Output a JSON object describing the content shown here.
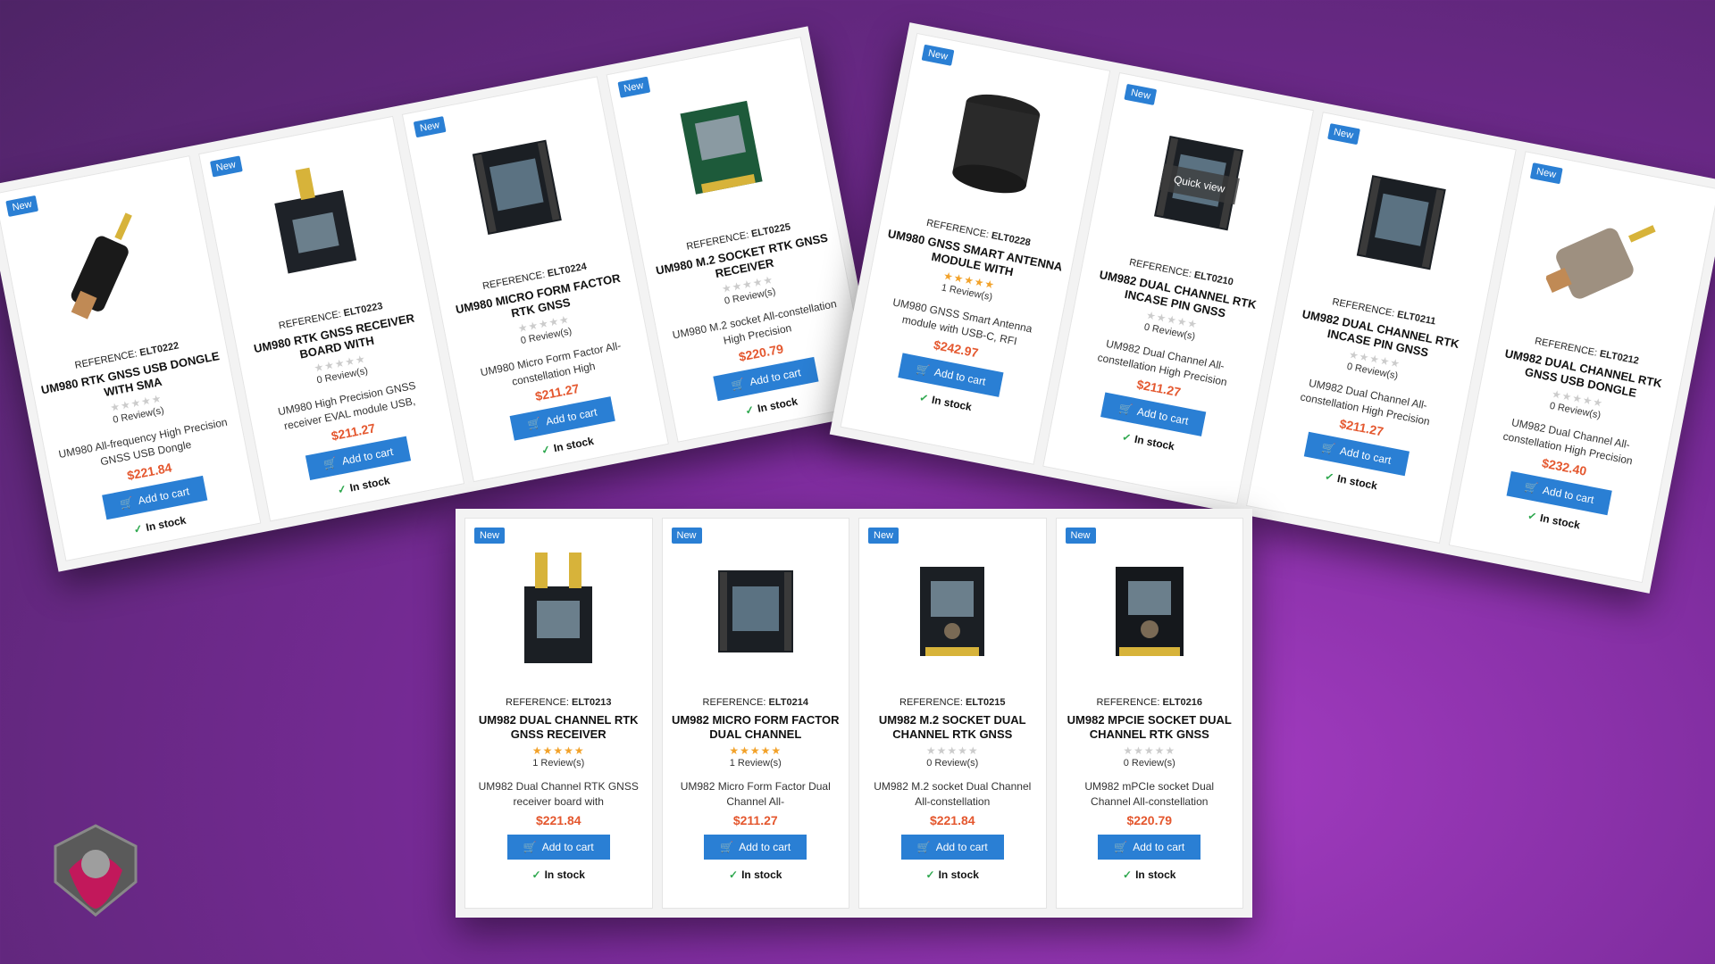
{
  "panels": {
    "top_left": [
      {
        "badge": "New",
        "ref_label": "REFERENCE:",
        "ref": "ELT0222",
        "title": "UM980 RTK GNSS USB DONGLE WITH SMA",
        "stars": 0,
        "reviews": "0 Review(s)",
        "desc": "UM980 All-frequency High Precision GNSS USB Dongle",
        "price": "$221.84",
        "cart": "Add to cart",
        "stock": "In stock",
        "device": "usb-dongle"
      },
      {
        "badge": "New",
        "ref_label": "REFERENCE:",
        "ref": "ELT0223",
        "title": "UM980 RTK GNSS RECEIVER BOARD WITH",
        "stars": 0,
        "reviews": "0 Review(s)",
        "desc": "UM980 High Precision GNSS receiver EVAL module USB,",
        "price": "$211.27",
        "cart": "Add to cart",
        "stock": "In stock",
        "device": "board"
      },
      {
        "badge": "New",
        "ref_label": "REFERENCE:",
        "ref": "ELT0224",
        "title": "UM980 MICRO FORM FACTOR RTK GNSS",
        "stars": 0,
        "reviews": "0 Review(s)",
        "desc": "UM980 Micro Form Factor All-constellation High",
        "price": "$211.27",
        "cart": "Add to cart",
        "stock": "In stock",
        "device": "micro-board"
      },
      {
        "badge": "New",
        "ref_label": "REFERENCE:",
        "ref": "ELT0225",
        "title": "UM980 M.2 SOCKET RTK GNSS RECEIVER",
        "stars": 0,
        "reviews": "0 Review(s)",
        "desc": "UM980 M.2 socket All-constellation High Precision",
        "price": "$220.79",
        "cart": "Add to cart",
        "stock": "In stock",
        "device": "m2"
      }
    ],
    "top_right": [
      {
        "badge": "New",
        "ref_label": "REFERENCE:",
        "ref": "ELT0228",
        "title": "UM980 GNSS SMART ANTENNA MODULE WITH",
        "stars": 5,
        "reviews": "1 Review(s)",
        "desc": "UM980 GNSS Smart Antenna module with USB-C, RFI",
        "price": "$242.97",
        "cart": "Add to cart",
        "stock": "In stock",
        "device": "antenna"
      },
      {
        "badge": "New",
        "ref_label": "REFERENCE:",
        "ref": "ELT0210",
        "title": "UM982 DUAL CHANNEL RTK INCASE PIN GNSS",
        "stars": 0,
        "reviews": "0 Review(s)",
        "desc": "UM982 Dual Channel All-constellation High Precision",
        "price": "$211.27",
        "cart": "Add to cart",
        "stock": "In stock",
        "device": "micro-board",
        "quick": "Quick view"
      },
      {
        "badge": "New",
        "ref_label": "REFERENCE:",
        "ref": "ELT0211",
        "title": "UM982 DUAL CHANNEL RTK INCASE PIN GNSS",
        "stars": 0,
        "reviews": "0 Review(s)",
        "desc": "UM982 Dual Channel All-constellation High Precision",
        "price": "$211.27",
        "cart": "Add to cart",
        "stock": "In stock",
        "device": "micro-board"
      },
      {
        "badge": "New",
        "ref_label": "REFERENCE:",
        "ref": "ELT0212",
        "title": "UM982 DUAL CHANNEL RTK GNSS USB DONGLE",
        "stars": 0,
        "reviews": "0 Review(s)",
        "desc": "UM982 Dual Channel All-constellation High Precision",
        "price": "$232.40",
        "cart": "Add to cart",
        "stock": "In stock",
        "device": "usb-clear"
      }
    ],
    "bottom": [
      {
        "badge": "New",
        "ref_label": "REFERENCE:",
        "ref": "ELT0213",
        "title": "UM982 DUAL CHANNEL RTK GNSS RECEIVER",
        "stars": 5,
        "reviews": "1 Review(s)",
        "desc": "UM982 Dual Channel RTK GNSS receiver board with",
        "price": "$221.84",
        "cart": "Add to cart",
        "stock": "In stock",
        "device": "dual-sma"
      },
      {
        "badge": "New",
        "ref_label": "REFERENCE:",
        "ref": "ELT0214",
        "title": "UM982 MICRO FORM FACTOR DUAL CHANNEL",
        "stars": 5,
        "reviews": "1 Review(s)",
        "desc": "UM982 Micro Form Factor Dual Channel All-",
        "price": "$211.27",
        "cart": "Add to cart",
        "stock": "In stock",
        "device": "micro-board"
      },
      {
        "badge": "New",
        "ref_label": "REFERENCE:",
        "ref": "ELT0215",
        "title": "UM982 M.2 SOCKET DUAL CHANNEL RTK GNSS",
        "stars": 0,
        "reviews": "0 Review(s)",
        "desc": "UM982 M.2 socket Dual Channel All-constellation",
        "price": "$221.84",
        "cart": "Add to cart",
        "stock": "In stock",
        "device": "m2-dark"
      },
      {
        "badge": "New",
        "ref_label": "REFERENCE:",
        "ref": "ELT0216",
        "title": "UM982 MPCIE SOCKET DUAL CHANNEL RTK GNSS",
        "stars": 0,
        "reviews": "0 Review(s)",
        "desc": "UM982 mPCIe socket Dual Channel All-constellation",
        "price": "$220.79",
        "cart": "Add to cart",
        "stock": "In stock",
        "device": "mpcie"
      }
    ]
  },
  "colors": {
    "accent": "#2a7fd4",
    "price": "#e4572e",
    "star": "#f2a22a",
    "check": "#2fa84f"
  }
}
